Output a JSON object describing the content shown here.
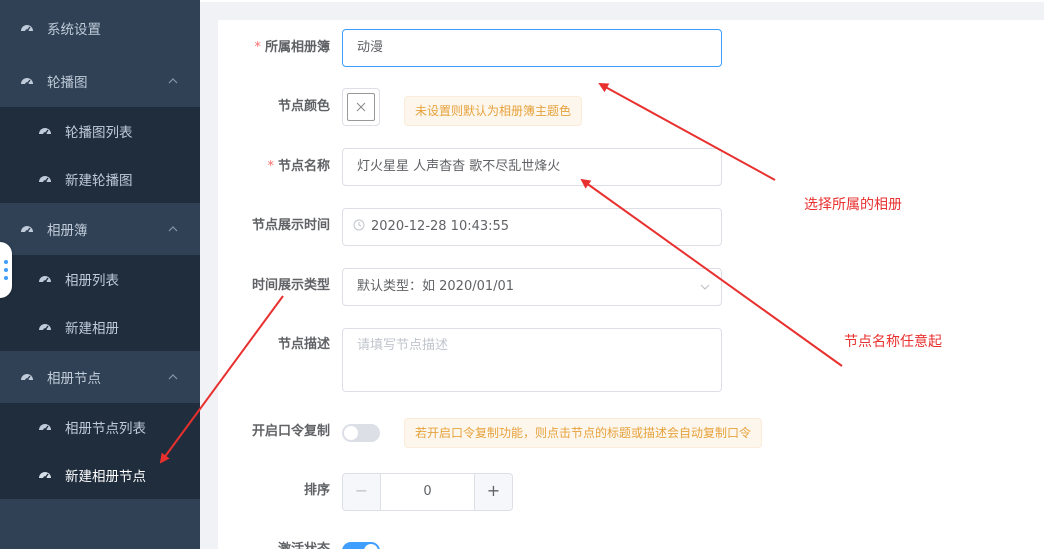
{
  "sidebar": {
    "items": [
      {
        "label": "系统设置",
        "type": "top",
        "expanded": null
      },
      {
        "label": "轮播图",
        "type": "top",
        "expanded": true
      },
      {
        "label": "轮播图列表",
        "type": "sub"
      },
      {
        "label": "新建轮播图",
        "type": "sub"
      },
      {
        "label": "相册簿",
        "type": "top",
        "expanded": true
      },
      {
        "label": "相册列表",
        "type": "sub"
      },
      {
        "label": "新建相册",
        "type": "sub"
      },
      {
        "label": "相册节点",
        "type": "top",
        "expanded": true
      },
      {
        "label": "相册节点列表",
        "type": "sub"
      },
      {
        "label": "新建相册节点",
        "type": "sub",
        "active": true
      }
    ],
    "icon": "dashboard-icon"
  },
  "form": {
    "album": {
      "label": "所属相册簿",
      "required": true,
      "value": "动漫"
    },
    "color": {
      "label": "节点颜色",
      "tip": "未设置则默认为相册簿主题色"
    },
    "name": {
      "label": "节点名称",
      "required": true,
      "value": "灯火星星 人声杳杳 歌不尽乱世烽火"
    },
    "time": {
      "label": "节点展示时间",
      "value": "2020-12-28 10:43:55"
    },
    "time_type": {
      "label": "时间展示类型",
      "value": "默认类型：如 2020/01/01"
    },
    "desc": {
      "label": "节点描述",
      "placeholder": "请填写节点描述"
    },
    "copy": {
      "label": "开启口令复制",
      "on": false,
      "tip": "若开启口令复制功能，则点击节点的标题或描述会自动复制口令"
    },
    "sort": {
      "label": "排序",
      "value": "0",
      "minus": "−",
      "plus": "+"
    },
    "active": {
      "label": "激活状态",
      "on": true
    }
  },
  "annotations": {
    "album_note": "选择所属的相册",
    "name_note": "节点名称任意起"
  },
  "colors": {
    "sidebar_bg": "#304156",
    "submenu_bg": "#1f2d3d",
    "primary": "#409eff",
    "required": "#f56c6c",
    "warning": "#e6a23c",
    "annotation": "#e8312f"
  }
}
